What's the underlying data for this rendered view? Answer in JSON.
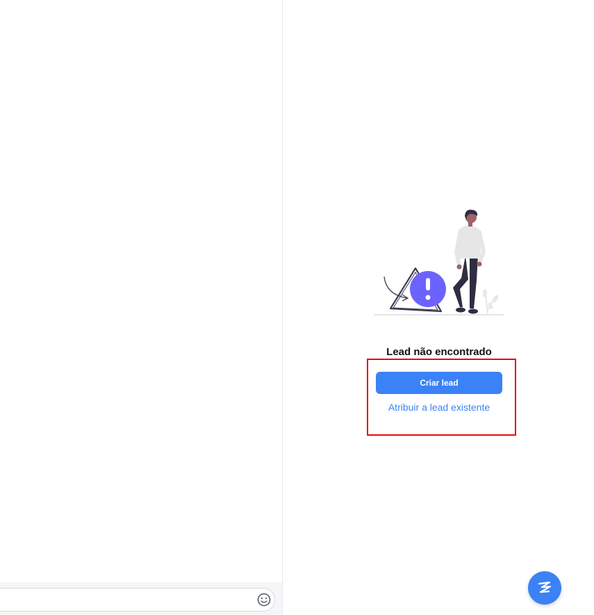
{
  "empty_state": {
    "title": "Lead não encontrado",
    "illustration_icon": "warning-person-illustration"
  },
  "actions": {
    "create_lead_label": "Criar lead",
    "assign_existing_label": "Atribuir a lead existente"
  },
  "composer": {
    "message_value": "",
    "emoji_icon": "smiley-icon"
  },
  "fab": {
    "icon": "chat-logo-icon"
  },
  "colors": {
    "accent": "#3b82f6",
    "highlight": "#e00d0d",
    "illustration_purple": "#6c63ff",
    "divider": "#e5e7eb"
  }
}
